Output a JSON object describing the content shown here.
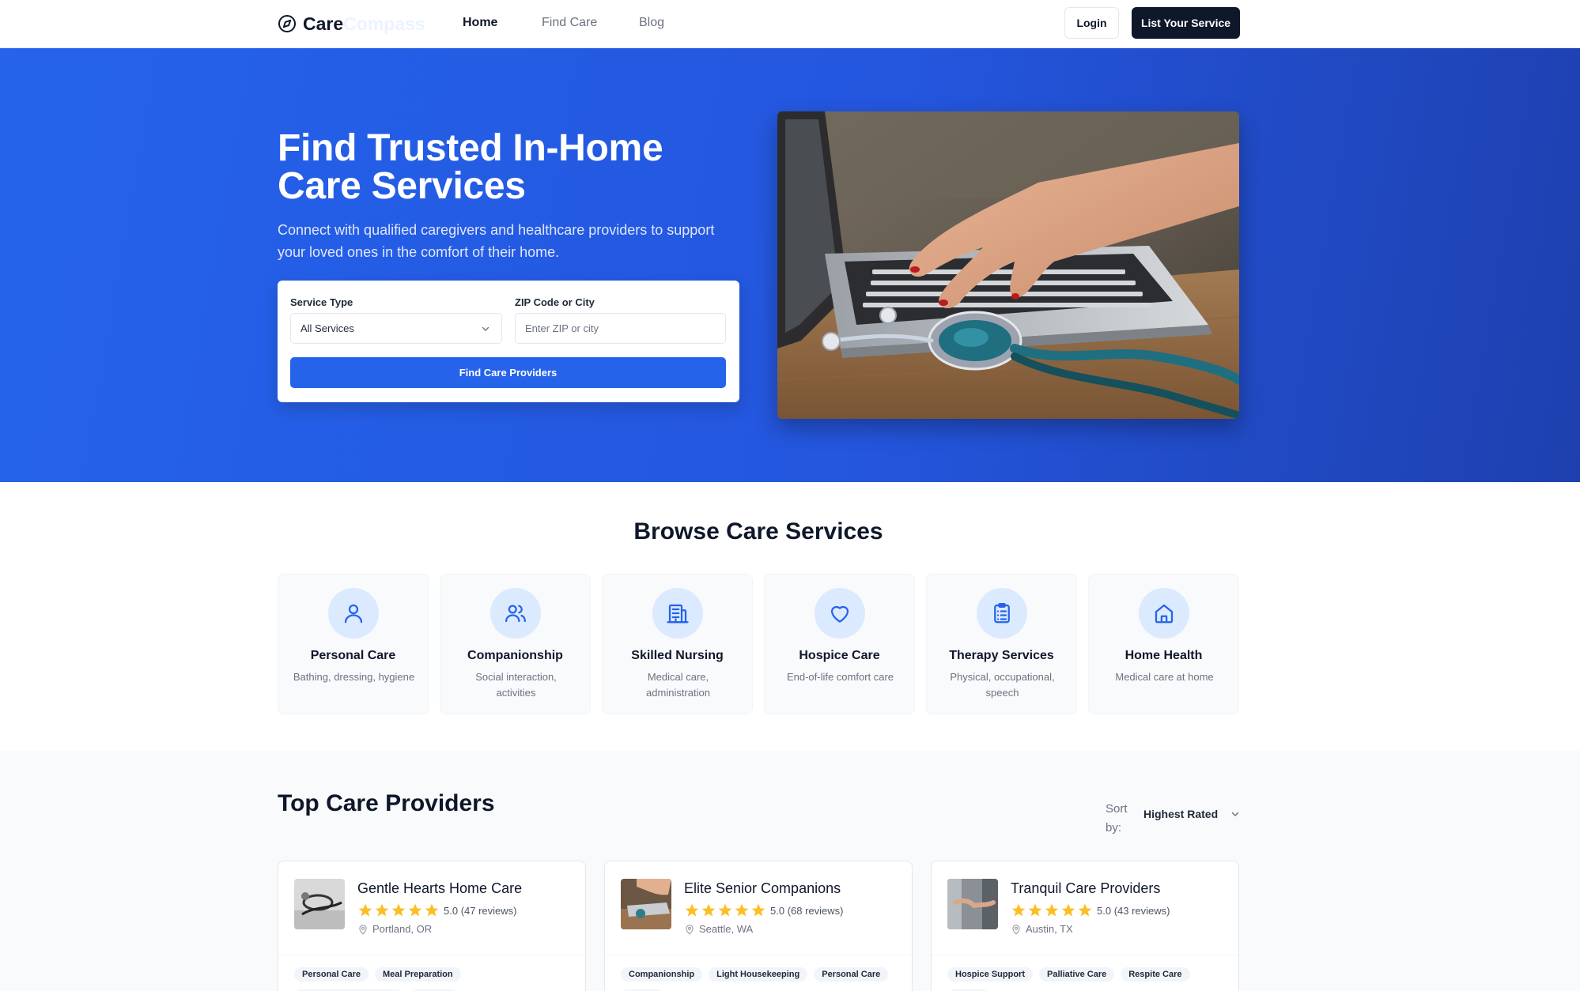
{
  "brand": {
    "name_bold": "Care",
    "name_light": "Compass"
  },
  "nav": {
    "items": [
      {
        "label": "Home",
        "active": true
      },
      {
        "label": "Find Care"
      },
      {
        "label": "Blog"
      }
    ]
  },
  "header": {
    "login_label": "Login",
    "list_label": "List Your Service"
  },
  "hero": {
    "title": "Find Trusted In-Home Care Services",
    "subtitle": "Connect with qualified caregivers and healthcare providers to support your loved ones in the comfort of their home.",
    "image_alt": "Hands typing on a laptop with a stethoscope on a wooden desk"
  },
  "search": {
    "service_label": "Service Type",
    "service_value": "All Services",
    "zip_label": "ZIP Code or City",
    "zip_placeholder": "Enter ZIP or city",
    "button_label": "Find Care Providers"
  },
  "browse": {
    "title": "Browse Care Services",
    "services": [
      {
        "title": "Personal Care",
        "desc": "Bathing, dressing, hygiene",
        "icon": "user-icon"
      },
      {
        "title": "Companionship",
        "desc": "Social interaction, activities",
        "icon": "users-icon"
      },
      {
        "title": "Skilled Nursing",
        "desc": "Medical care, administration",
        "icon": "hospital-icon"
      },
      {
        "title": "Hospice Care",
        "desc": "End-of-life comfort care",
        "icon": "heart-icon"
      },
      {
        "title": "Therapy Services",
        "desc": "Physical, occupational, speech",
        "icon": "clipboard-icon"
      },
      {
        "title": "Home Health",
        "desc": "Medical care at home",
        "icon": "home-icon"
      }
    ]
  },
  "providers": {
    "title": "Top Care Providers",
    "sort_label": "Sort by:",
    "sort_value": "Highest Rated",
    "items": [
      {
        "name": "Gentle Hearts Home Care",
        "rating": "5.0",
        "reviews": "(47 reviews)",
        "location": "Portland, OR",
        "tags": [
          "Personal Care",
          "Meal Preparation"
        ]
      },
      {
        "name": "Elite Senior Companions",
        "rating": "5.0",
        "reviews": "(68 reviews)",
        "location": "Seattle, WA",
        "tags": [
          "Companionship",
          "Light Housekeeping",
          "Personal Care"
        ]
      },
      {
        "name": "Tranquil Care Providers",
        "rating": "5.0",
        "reviews": "(43 reviews)",
        "location": "Austin, TX",
        "tags": [
          "Hospice Support",
          "Palliative Care",
          "Respite Care"
        ]
      }
    ]
  },
  "colors": {
    "primary": "#2563eb",
    "dark": "#0f172a",
    "star": "#fbbf24",
    "icon_bg": "#dbeafe"
  }
}
